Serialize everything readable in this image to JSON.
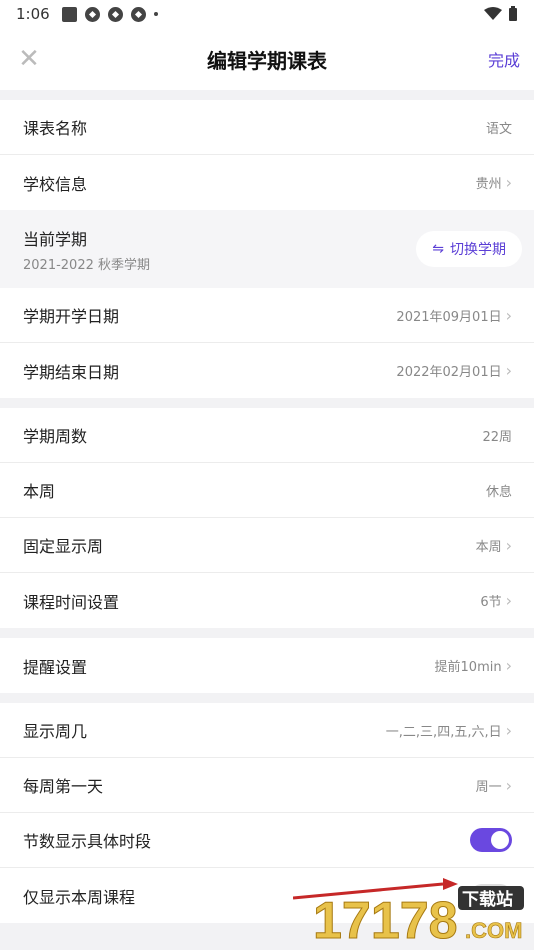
{
  "status": {
    "time": "1:06"
  },
  "nav": {
    "title": "编辑学期课表",
    "done": "完成"
  },
  "group1": {
    "course_name": {
      "label": "课表名称",
      "value": "语文"
    },
    "school": {
      "label": "学校信息",
      "value": "贵州"
    }
  },
  "term": {
    "title": "当前学期",
    "subtitle": "2021-2022 秋季学期",
    "switch_label": "切换学期",
    "switch_icon": "swap-arrows-icon"
  },
  "group2": {
    "start": {
      "label": "学期开学日期",
      "value": "2021年09月01日"
    },
    "end": {
      "label": "学期结束日期",
      "value": "2022年02月01日"
    }
  },
  "group3": {
    "weeks": {
      "label": "学期周数",
      "value": "22周"
    },
    "this_week": {
      "label": "本周",
      "value": "休息"
    },
    "fixed_week": {
      "label": "固定显示周",
      "value": "本周"
    },
    "time_setting": {
      "label": "课程时间设置",
      "value": "6节"
    }
  },
  "group4": {
    "reminder": {
      "label": "提醒设置",
      "value": "提前10min"
    }
  },
  "group5": {
    "weekdays": {
      "label": "显示周几",
      "value": "一,二,三,四,五,六,日"
    },
    "first_day": {
      "label": "每周第一天",
      "value": "周一"
    },
    "show_time": {
      "label": "节数显示具体时段",
      "on": true
    },
    "only_week": {
      "label": "仅显示本周课程",
      "on": false
    }
  },
  "watermark": {
    "text1": "17178",
    "text2": "下载站",
    "text3": ".COM"
  },
  "colors": {
    "accent": "#5b3fd6",
    "toggle_on": "#6a48e0",
    "watermark": "#e8c24a"
  }
}
